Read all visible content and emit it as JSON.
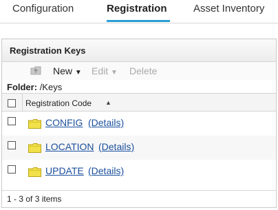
{
  "tabs": [
    "Configuration",
    "Registration",
    "Asset Inventory"
  ],
  "active_tab": "Registration",
  "accent_color": "#2a9fd6",
  "panel": {
    "title": "Registration Keys",
    "toolbar": {
      "up_icon": "folder-up-icon",
      "new_label": "New",
      "edit_label": "Edit",
      "delete_label": "Delete"
    },
    "folder_label": "Folder:",
    "folder_path": "/Keys",
    "column_header": "Registration Code",
    "rows": [
      {
        "name": "CONFIG",
        "details": "(Details)"
      },
      {
        "name": "LOCATION",
        "details": "(Details)"
      },
      {
        "name": "UPDATE",
        "details": "(Details)"
      }
    ],
    "footer": "1 - 3 of 3 items"
  }
}
